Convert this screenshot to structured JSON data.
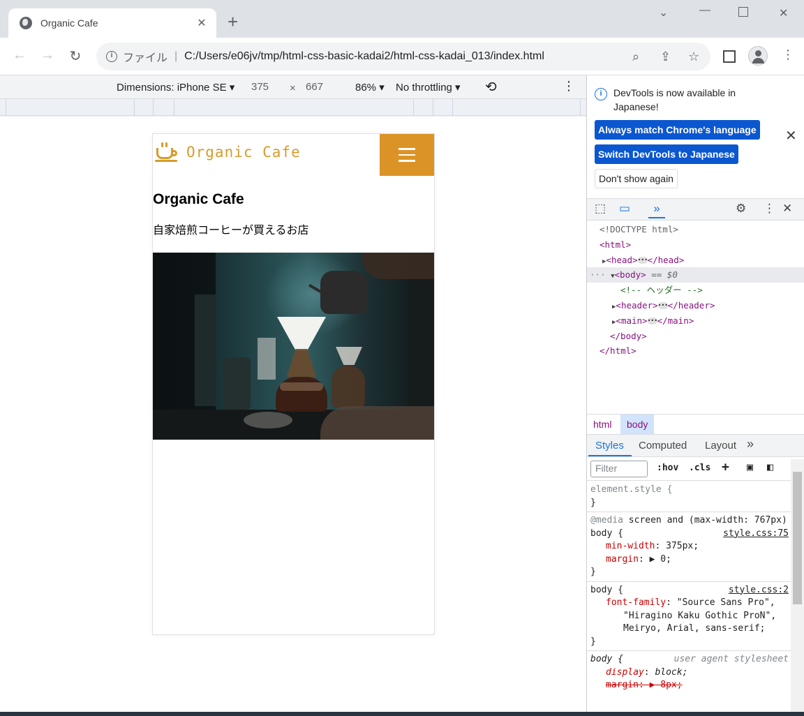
{
  "browser": {
    "tab_title": "Organic Cafe",
    "tab_close": "✕",
    "new_tab": "+",
    "omnibox_label": "ファイル",
    "url": "C:/Users/e06jv/tmp/html-css-basic-kadai2/html-css-kadai_013/index.html"
  },
  "device_toolbar": {
    "dimensions_label": "Dimensions: iPhone SE",
    "width": "375",
    "times": "×",
    "height": "667",
    "zoom": "86%",
    "throttling": "No throttling"
  },
  "page": {
    "logo_text": "Organic Cafe",
    "title": "Organic Cafe",
    "lead": "自家焙煎コーヒーが買えるお店",
    "brand_color": "#dc9326"
  },
  "devtools": {
    "notice": {
      "message": "DevTools is now available in Japanese!",
      "match_button": "Always match Chrome's language",
      "switch_button": "Switch DevTools to Japanese",
      "dont_show": "Don't show again"
    },
    "dom": {
      "doctype": "<!DOCTYPE html>",
      "html_open": "<html>",
      "head_open": "<head>",
      "head_close": "</head>",
      "body_open": "<body>",
      "body_marker": "== $0",
      "comment": "<!-- ヘッダー -->",
      "header_open": "<header>",
      "header_close": "</header>",
      "main_open": "<main>",
      "main_close": "</main>",
      "body_close": "</body>",
      "html_close": "</html>"
    },
    "breadcrumbs": [
      "html",
      "body"
    ],
    "tabs": [
      "Styles",
      "Computed",
      "Layout"
    ],
    "filter_placeholder": "Filter",
    "hov": ":hov",
    "cls": ".cls",
    "styles": {
      "element_style": "element.style {",
      "close_brace": "}",
      "media_at": "@media",
      "media_query": "screen and (max-width: 767px)",
      "body_sel": "body {",
      "src1": "style.css:75",
      "min_width_prop": "min-width",
      "min_width_val": "375px;",
      "margin_prop": "margin",
      "margin_val": "0;",
      "src2": "style.css:2",
      "font_family_prop": "font-family",
      "font_family_val1": "\"Source Sans Pro\",",
      "font_family_val2": "\"Hiragino Kaku Gothic ProN\",",
      "font_family_val3": "Meiryo, Arial, sans-serif;",
      "ua_label": "user agent stylesheet",
      "display_prop": "display",
      "display_val": "block;",
      "ua_margin_prop": "margin",
      "ua_margin_val": "8px;"
    }
  }
}
